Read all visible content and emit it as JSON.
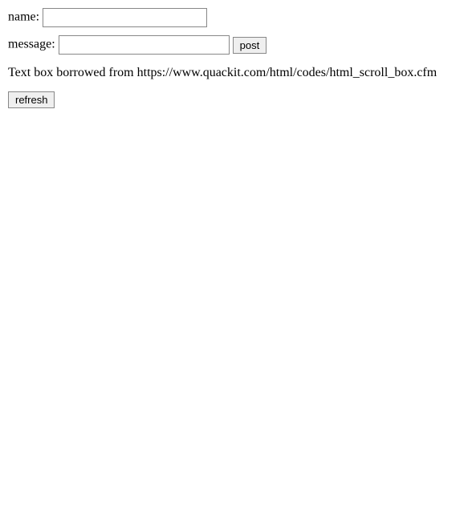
{
  "form": {
    "name_label": "name:",
    "name_value": "",
    "message_label": "message:",
    "message_value": "",
    "post_button": "post"
  },
  "credit_text": "Text box borrowed from https://www.quackit.com/html/codes/html_scroll_box.cfm",
  "refresh_button": "refresh"
}
